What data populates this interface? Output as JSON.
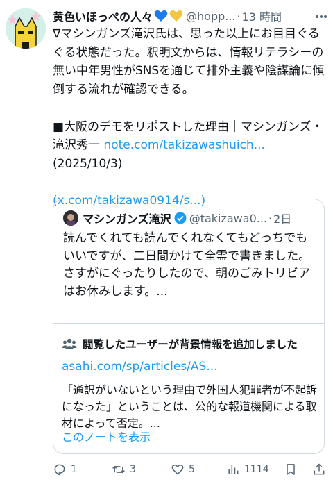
{
  "post": {
    "author_name": "黄色いほっぺの人々",
    "handle": "@hopp...",
    "separator": "·",
    "time": "13 時間",
    "body_line1": "∇マシンガンズ滝沢氏は、思った以上にお目目ぐるぐる状態だった。釈明文からは、情報リテラシーの無い中年男性がSNSを通じて排外主義や陰謀論に傾倒する流れが確認できる。",
    "body_line2_prefix": "■大阪のデモをリポストした理由｜マシンガンズ・滝沢秀一 ",
    "body_link1": "note.com/takizawashuich...",
    "body_date": "(2025/10/3)",
    "body_link2_open": "(",
    "body_link2": "x.com/takizawa0914/s...",
    "body_link2_close": ")"
  },
  "quote": {
    "name": "マシンガンズ滝沢",
    "handle": "@takizawa0...",
    "separator": "·",
    "time": "2日",
    "text": "読んでくれても読んでくれなくてもどっちでもいいですが、二日間かけて全霊で書きました。\nさすがにぐったりしたので、朝のごみトリビアはお休みします。..."
  },
  "community_note": {
    "title": "閲覧したユーザーが背景情報を追加しました",
    "link": "asahi.com/sp/articles/AS...",
    "text": "「通訳がいないという理由で外国人犯罪者が不起訴になった」ということは、公的な報道機関による取材によって否定。...",
    "show_more": "このノートを表示"
  },
  "actions": {
    "reply_count": "1",
    "repost_count": "3",
    "like_count": "5",
    "views_count": "1114"
  },
  "colors": {
    "link": "#1d9bf0",
    "muted": "#536471",
    "heart_blue": "#1d7bf0",
    "heart_yellow": "#f5c542",
    "verified": "#1d9bf0"
  }
}
